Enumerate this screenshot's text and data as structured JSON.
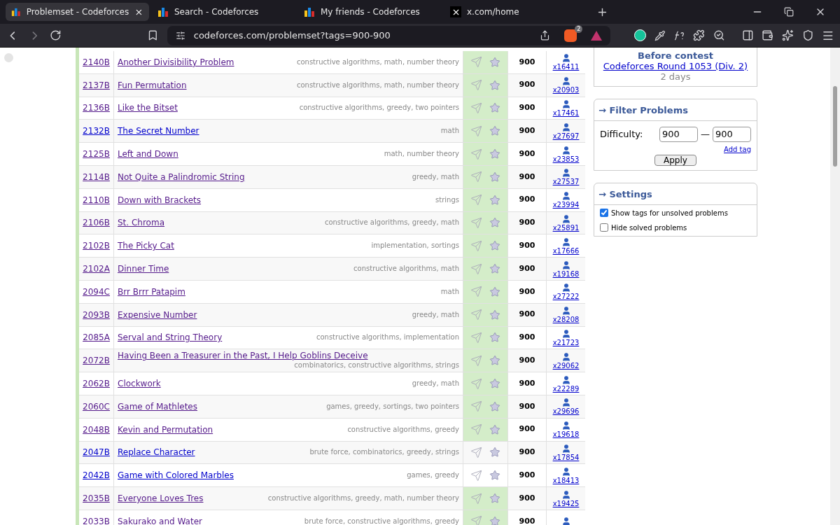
{
  "browser": {
    "tabs": [
      {
        "title": "Problemset - Codeforces",
        "selected": true,
        "kind": "bars"
      },
      {
        "title": "Search - Codeforces",
        "selected": false,
        "kind": "bars"
      },
      {
        "title": "My friends - Codeforces",
        "selected": false,
        "kind": "bars"
      },
      {
        "title": "x.com/home",
        "selected": false,
        "kind": "x"
      }
    ],
    "address": "codeforces.com/problemset?tags=900-900",
    "shield_badge": "2"
  },
  "problems": [
    {
      "id": "2140B",
      "name": "Another Divisibility Problem",
      "tags": "constructive algorithms, math, number theory",
      "solved": true,
      "visited": true,
      "difficulty": "900",
      "solvers": "x16411"
    },
    {
      "id": "2137B",
      "name": "Fun Permutation",
      "tags": "constructive algorithms, math, number theory",
      "solved": true,
      "visited": true,
      "difficulty": "900",
      "solvers": "x20903"
    },
    {
      "id": "2136B",
      "name": "Like the Bitset",
      "tags": "constructive algorithms, greedy, two pointers",
      "solved": true,
      "visited": true,
      "difficulty": "900",
      "solvers": "x17461"
    },
    {
      "id": "2132B",
      "name": "The Secret Number",
      "tags": "math",
      "solved": true,
      "visited": false,
      "difficulty": "900",
      "solvers": "x27697"
    },
    {
      "id": "2125B",
      "name": "Left and Down",
      "tags": "math, number theory",
      "solved": true,
      "visited": true,
      "difficulty": "900",
      "solvers": "x23853"
    },
    {
      "id": "2114B",
      "name": "Not Quite a Palindromic String",
      "tags": "greedy, math",
      "solved": true,
      "visited": true,
      "difficulty": "900",
      "solvers": "x27537"
    },
    {
      "id": "2110B",
      "name": "Down with Brackets",
      "tags": "strings",
      "solved": true,
      "visited": true,
      "difficulty": "900",
      "solvers": "x23994"
    },
    {
      "id": "2106B",
      "name": "St. Chroma",
      "tags": "constructive algorithms, greedy, math",
      "solved": true,
      "visited": true,
      "difficulty": "900",
      "solvers": "x25891"
    },
    {
      "id": "2102B",
      "name": "The Picky Cat",
      "tags": "implementation, sortings",
      "solved": true,
      "visited": true,
      "difficulty": "900",
      "solvers": "x17666"
    },
    {
      "id": "2102A",
      "name": "Dinner Time",
      "tags": "constructive algorithms, math",
      "solved": true,
      "visited": true,
      "difficulty": "900",
      "solvers": "x19168"
    },
    {
      "id": "2094C",
      "name": "Brr Brrr Patapim",
      "tags": "math",
      "solved": true,
      "visited": true,
      "difficulty": "900",
      "solvers": "x27222"
    },
    {
      "id": "2093B",
      "name": "Expensive Number",
      "tags": "greedy, math",
      "solved": true,
      "visited": true,
      "difficulty": "900",
      "solvers": "x28208"
    },
    {
      "id": "2085A",
      "name": "Serval and String Theory",
      "tags": "constructive algorithms, implementation",
      "solved": true,
      "visited": true,
      "difficulty": "900",
      "solvers": "x21723"
    },
    {
      "id": "2072B",
      "name": "Having Been a Treasurer in the Past, I Help Goblins Deceive",
      "tags": "combinatorics, constructive algorithms, strings",
      "solved": true,
      "visited": true,
      "difficulty": "900",
      "solvers": "x29062"
    },
    {
      "id": "2062B",
      "name": "Clockwork",
      "tags": "greedy, math",
      "solved": true,
      "visited": true,
      "difficulty": "900",
      "solvers": "x22289"
    },
    {
      "id": "2060C",
      "name": "Game of Mathletes",
      "tags": "games, greedy, sortings, two pointers",
      "solved": true,
      "visited": true,
      "difficulty": "900",
      "solvers": "x29696"
    },
    {
      "id": "2048B",
      "name": "Kevin and Permutation",
      "tags": "constructive algorithms, greedy",
      "solved": true,
      "visited": true,
      "difficulty": "900",
      "solvers": "x19618"
    },
    {
      "id": "2047B",
      "name": "Replace Character",
      "tags": "brute force, combinatorics, greedy, strings",
      "solved": false,
      "visited": false,
      "difficulty": "900",
      "solvers": "x17854"
    },
    {
      "id": "2042B",
      "name": "Game with Colored Marbles",
      "tags": "games, greedy",
      "solved": false,
      "visited": false,
      "difficulty": "900",
      "solvers": "x18413"
    },
    {
      "id": "2035B",
      "name": "Everyone Loves Tres",
      "tags": "constructive algorithms, greedy, math, number theory",
      "solved": true,
      "visited": true,
      "difficulty": "900",
      "solvers": "x19425"
    },
    {
      "id": "2033B",
      "name": "Sakurako and Water",
      "tags": "brute force, constructive algorithms, greedy",
      "solved": true,
      "visited": true,
      "difficulty": "900"
    }
  ],
  "sidebar": {
    "contest": {
      "heading": "Before contest",
      "link": "Codeforces Round 1053 (Div. 2)",
      "countdown": "2 days"
    },
    "filter": {
      "title": "→ Filter Problems",
      "difficulty_label": "Difficulty:",
      "min": "900",
      "separator": "—",
      "max": "900",
      "add_tag": "Add tag",
      "apply": "Apply"
    },
    "settings": {
      "title": "→ Settings",
      "options": [
        {
          "label": "Show tags for unsolved problems",
          "checked": true
        },
        {
          "label": "Hide solved problems",
          "checked": false
        }
      ]
    }
  }
}
